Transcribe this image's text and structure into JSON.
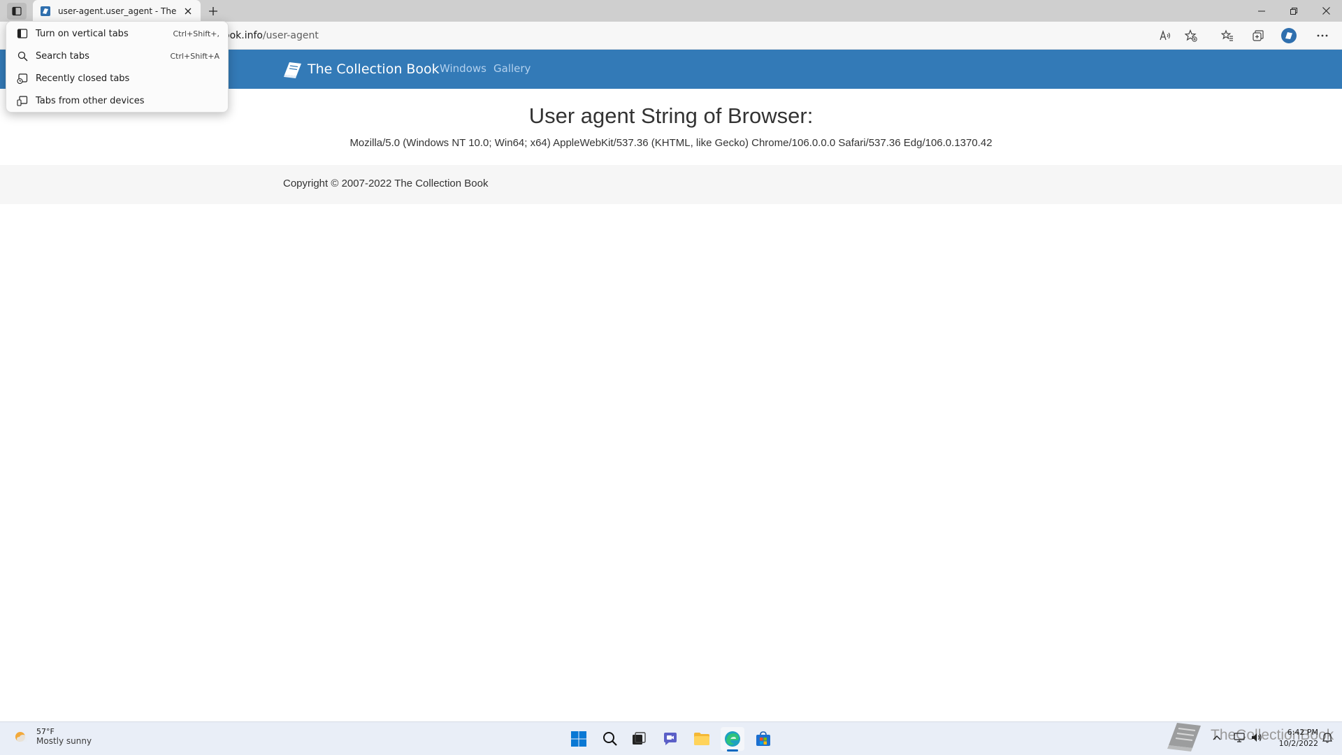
{
  "browser": {
    "active_tab": {
      "title": "user-agent.user_agent - The Coll"
    },
    "address": {
      "host_fragment": "ook.info",
      "path": "/user-agent"
    }
  },
  "tab_menu": {
    "items": [
      {
        "label": "Turn on vertical tabs",
        "shortcut": "Ctrl+Shift+,",
        "icon": "vertical-tabs-icon"
      },
      {
        "label": "Search tabs",
        "shortcut": "Ctrl+Shift+A",
        "icon": "search-icon"
      },
      {
        "label": "Recently closed tabs",
        "shortcut": "",
        "icon": "recently-closed-icon"
      },
      {
        "label": "Tabs from other devices",
        "shortcut": "",
        "icon": "devices-icon"
      }
    ]
  },
  "site": {
    "brand": "The Collection Book",
    "nav": [
      "Windows",
      "Gallery"
    ],
    "heading": "User agent String of Browser:",
    "ua_string": "Mozilla/5.0 (Windows NT 10.0; Win64; x64) AppleWebKit/537.36 (KHTML, like Gecko) Chrome/106.0.0.0 Safari/537.36 Edg/106.0.1370.42",
    "copyright": "Copyright © 2007-2022 The Collection Book",
    "brand_color": "#337ab7"
  },
  "taskbar": {
    "weather": {
      "temp": "57°F",
      "condition": "Mostly sunny"
    },
    "clock": {
      "time": "6:42 PM",
      "date": "10/2/2022"
    },
    "watermark": "TheCollectionBook"
  }
}
